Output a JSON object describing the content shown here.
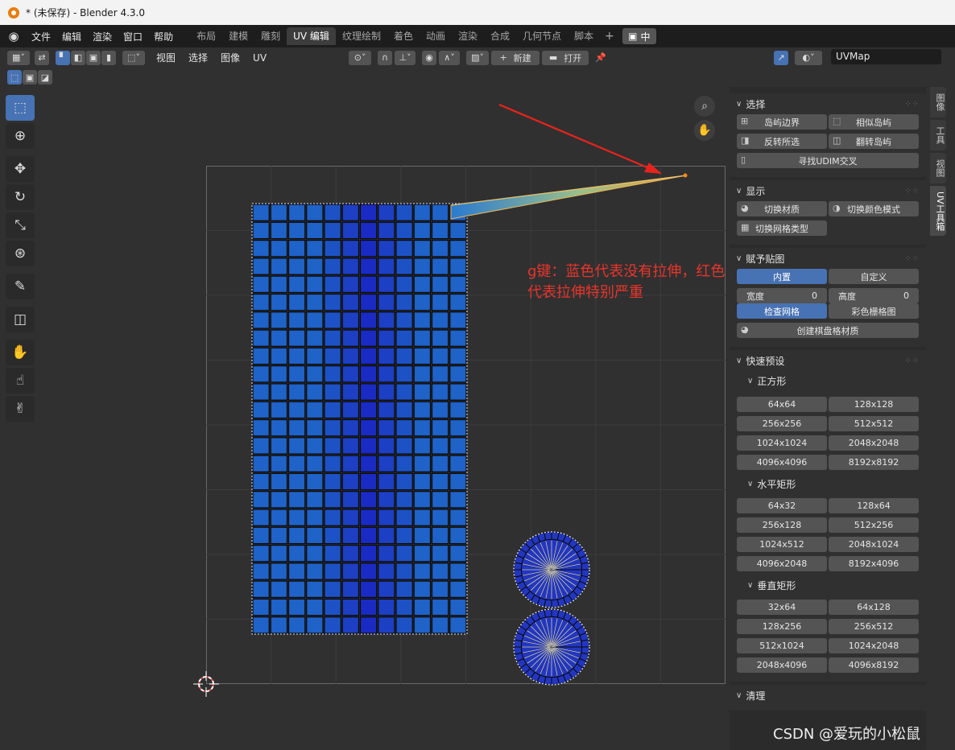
{
  "window": {
    "title": "* (未保存) - Blender 4.3.0"
  },
  "menu": [
    "文件",
    "编辑",
    "渲染",
    "窗口",
    "帮助"
  ],
  "workspaces": [
    "布局",
    "建模",
    "雕刻",
    "UV 编辑",
    "纹理绘制",
    "着色",
    "动画",
    "渲染",
    "合成",
    "几何节点",
    "脚本"
  ],
  "active_workspace": "UV 编辑",
  "scene_button": "中",
  "header": {
    "menus": [
      "视图",
      "选择",
      "图像",
      "UV"
    ],
    "new_label": "新建",
    "open_label": "打开",
    "uvmap": "UVMap"
  },
  "annotation": "g键：蓝色代表没有拉伸，红色代表拉伸特别严重",
  "sidebar_tabs": [
    "图像",
    "工具",
    "视图",
    "UV工具箱"
  ],
  "panel": {
    "select": {
      "title": "选择",
      "buttons": [
        [
          "岛屿边界",
          "相似岛屿"
        ],
        [
          "反转所选",
          "翻转岛屿"
        ]
      ],
      "udim": "寻找UDIM交叉"
    },
    "display": {
      "title": "显示",
      "buttons": [
        "切换材质",
        "切换颜色模式"
      ],
      "grid_type": "切换网格类型"
    },
    "assign": {
      "title": "赋予贴图",
      "mode": [
        "内置",
        "自定义"
      ],
      "width_label": "宽度",
      "width_value": "0",
      "height_label": "高度",
      "height_value": "0",
      "grid": [
        "检查网格",
        "彩色栅格图"
      ],
      "create": "创建棋盘格材质"
    },
    "presets": {
      "title": "快速预设",
      "square": {
        "title": "正方形",
        "sizes": [
          [
            "64x64",
            "128x128"
          ],
          [
            "256x256",
            "512x512"
          ],
          [
            "1024x1024",
            "2048x2048"
          ],
          [
            "4096x4096",
            "8192x8192"
          ]
        ]
      },
      "horizontal": {
        "title": "水平矩形",
        "sizes": [
          [
            "64x32",
            "128x64"
          ],
          [
            "256x128",
            "512x256"
          ],
          [
            "1024x512",
            "2048x1024"
          ],
          [
            "4096x2048",
            "8192x4096"
          ]
        ]
      },
      "vertical": {
        "title": "垂直矩形",
        "sizes": [
          [
            "32x64",
            "64x128"
          ],
          [
            "128x256",
            "256x512"
          ],
          [
            "512x1024",
            "1024x2048"
          ],
          [
            "2048x4096",
            "4096x8192"
          ]
        ]
      }
    },
    "clean": {
      "title": "清理"
    }
  },
  "watermark": "CSDN @爱玩的小松鼠"
}
